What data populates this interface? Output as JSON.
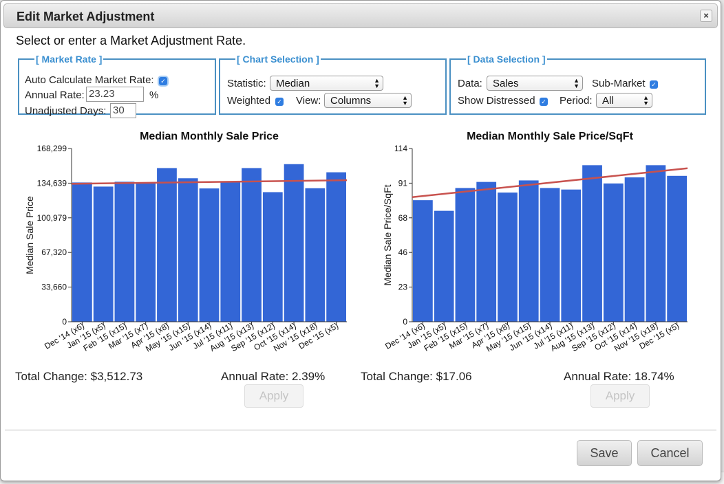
{
  "dialog": {
    "title": "Edit Market Adjustment",
    "close_glyph": "×",
    "instruction": "Select or enter a Market Adjustment Rate."
  },
  "market_rate": {
    "legend": "[ Market Rate ]",
    "auto_label": "Auto Calculate Market Rate:",
    "auto_checked": true,
    "annual_label": "Annual Rate:",
    "annual_value": "23.23",
    "percent": "%",
    "days_label": "Unadjusted Days:",
    "days_value": "30"
  },
  "chart_selection": {
    "legend": "[ Chart Selection ]",
    "statistic_label": "Statistic:",
    "statistic_value": "Median",
    "weighted_label": "Weighted",
    "weighted_checked": true,
    "view_label": "View:",
    "view_value": "Columns"
  },
  "data_selection": {
    "legend": "[ Data Selection ]",
    "data_label": "Data:",
    "data_value": "Sales",
    "submarket_label": "Sub-Market",
    "submarket_checked": true,
    "distressed_label": "Show Distressed",
    "distressed_checked": true,
    "period_label": "Period:",
    "period_value": "All"
  },
  "panels": {
    "left": {
      "total_change": "Total Change: $3,512.73",
      "annual_rate": "Annual Rate: 2.39%",
      "apply_label": "Apply"
    },
    "right": {
      "total_change": "Total Change: $17.06",
      "annual_rate": "Annual Rate: 18.74%",
      "apply_label": "Apply"
    }
  },
  "footer": {
    "save_label": "Save",
    "cancel_label": "Cancel"
  },
  "colors": {
    "bar": "#3366d6",
    "trend": "#c8524e",
    "legend": "#3a8fd0",
    "fieldset_border": "#4a90c2"
  },
  "chart_data": [
    {
      "type": "bar",
      "title": "Median Monthly Sale Price",
      "ylabel": "Median Sale Price",
      "xlabel": "",
      "ylim": [
        0,
        168299
      ],
      "yticks": [
        "0",
        "33,660",
        "67,320",
        "100,979",
        "134,639",
        "168,299"
      ],
      "categories": [
        "Dec '14 (x6)",
        "Jan '15 (x5)",
        "Feb '15 (x15)",
        "Mar '15 (x7)",
        "Apr '15 (x8)",
        "May '15 (x15)",
        "Jun '15 (x14)",
        "Jul '15 (x11)",
        "Aug '15 (x13)",
        "Sep '15 (x12)",
        "Oct '15 (x14)",
        "Nov '15 (x18)",
        "Dec '15 (x5)"
      ],
      "values": [
        135300,
        131300,
        136000,
        135300,
        149300,
        139400,
        129500,
        135800,
        149300,
        125900,
        153100,
        129700,
        145200
      ],
      "trend": [
        134000,
        137500
      ],
      "grid": false
    },
    {
      "type": "bar",
      "title": "Median Monthly Sale Price/SqFt",
      "ylabel": "Median Sale Price/SqFt",
      "xlabel": "",
      "ylim": [
        0,
        114
      ],
      "yticks": [
        "0",
        "23",
        "46",
        "68",
        "91",
        "114"
      ],
      "categories": [
        "Dec '14 (x6)",
        "Jan '15 (x5)",
        "Feb '15 (x15)",
        "Mar '15 (x7)",
        "Apr '15 (x8)",
        "May '15 (x15)",
        "Jun '15 (x14)",
        "Jul '15 (x11)",
        "Aug '15 (x13)",
        "Sep '15 (x12)",
        "Oct '15 (x14)",
        "Nov '15 (x18)",
        "Dec '15 (x5)"
      ],
      "values": [
        80,
        73,
        88,
        92,
        85,
        93,
        88,
        87,
        103,
        91,
        95,
        103,
        96
      ],
      "trend": [
        82,
        101
      ],
      "grid": false
    }
  ]
}
